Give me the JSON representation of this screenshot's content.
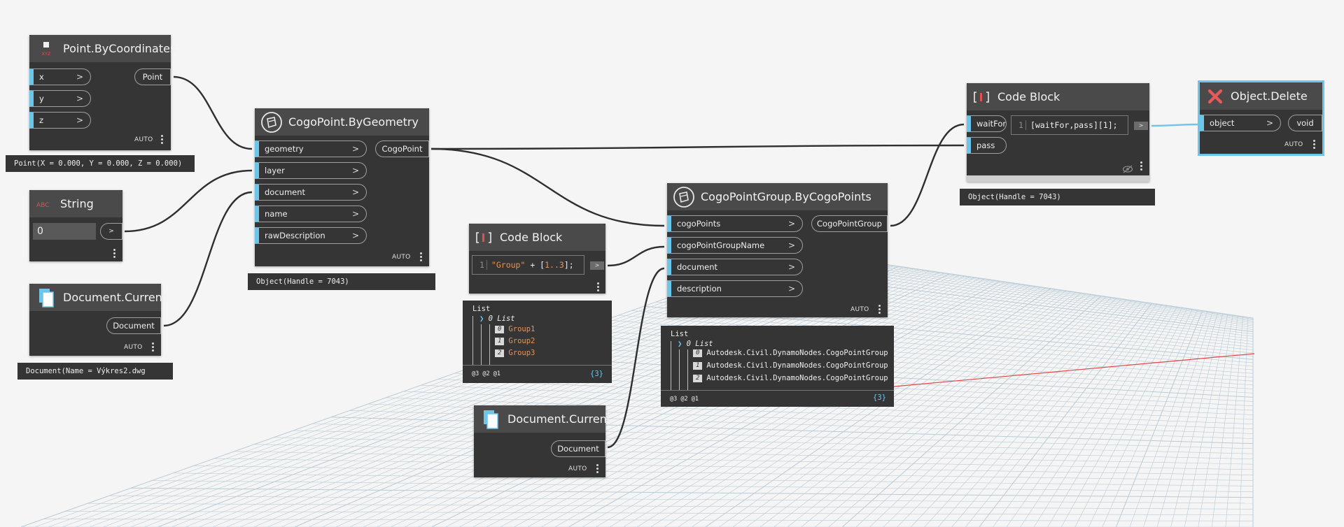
{
  "nodes": {
    "point_by_coordinates": {
      "title": "Point.ByCoordinates",
      "icon_label": "XYZ",
      "inputs": [
        "x",
        "y",
        "z"
      ],
      "output": "Point",
      "lacing": "AUTO",
      "preview": "Point(X = 0.000, Y = 0.000, Z = 0.000)"
    },
    "string": {
      "title": "String",
      "icon_label": "ABC",
      "value": "0",
      "output_arrow": ">"
    },
    "document_current_1": {
      "title": "Document.Current",
      "output": "Document",
      "lacing": "AUTO",
      "preview": "Document(Name = Výkres2.dwg"
    },
    "cogopoint_by_geometry": {
      "title": "CogoPoint.ByGeometry",
      "inputs": [
        "geometry",
        "layer",
        "document",
        "name",
        "rawDescription"
      ],
      "output": "CogoPoint",
      "lacing": "AUTO",
      "preview": "Object(Handle = 7043)"
    },
    "code_block_1": {
      "title": "Code Block",
      "line_no": "1",
      "code_string": "\"Group\"",
      "code_op": " + [",
      "code_range": "1..3",
      "code_end": "];",
      "output_arrow": ">",
      "preview": {
        "header": "List",
        "sub": "0 List",
        "items": [
          {
            "index": "0",
            "value": "Group1"
          },
          {
            "index": "1",
            "value": "Group2"
          },
          {
            "index": "2",
            "value": "Group3"
          }
        ],
        "levels": "@3 @2 @1",
        "count": "{3}"
      }
    },
    "document_current_2": {
      "title": "Document.Current",
      "output": "Document",
      "lacing": "AUTO"
    },
    "cogopointgroup_by_cogopoints": {
      "title": "CogoPointGroup.ByCogoPoints",
      "inputs": [
        "cogoPoints",
        "cogoPointGroupName",
        "document",
        "description"
      ],
      "output": "CogoPointGroup",
      "lacing": "AUTO",
      "preview": {
        "header": "List",
        "sub": "0 List",
        "items": [
          {
            "index": "0",
            "value": "Autodesk.Civil.DynamoNodes.CogoPointGroup"
          },
          {
            "index": "1",
            "value": "Autodesk.Civil.DynamoNodes.CogoPointGroup"
          },
          {
            "index": "2",
            "value": "Autodesk.Civil.DynamoNodes.CogoPointGroup"
          }
        ],
        "levels": "@3 @2 @1",
        "count": "{3}"
      }
    },
    "code_block_2": {
      "title": "Code Block",
      "inputs": [
        "waitFor",
        "pass"
      ],
      "line_no": "1",
      "code": "[waitFor,pass][1];",
      "output_arrow": ">",
      "preview": "Object(Handle = 7043)"
    },
    "object_delete": {
      "title": "Object.Delete",
      "input": "object",
      "output": "void",
      "lacing": "AUTO"
    }
  },
  "colors": {
    "node_body": "#353535",
    "node_header": "#4a4a4a",
    "port_accent": "#6dc6ea",
    "wire": "#2f2f2f",
    "selected_outline": "#6dc6ea",
    "grid_line": "#b9cbd6",
    "axis_red": "#e04848"
  }
}
